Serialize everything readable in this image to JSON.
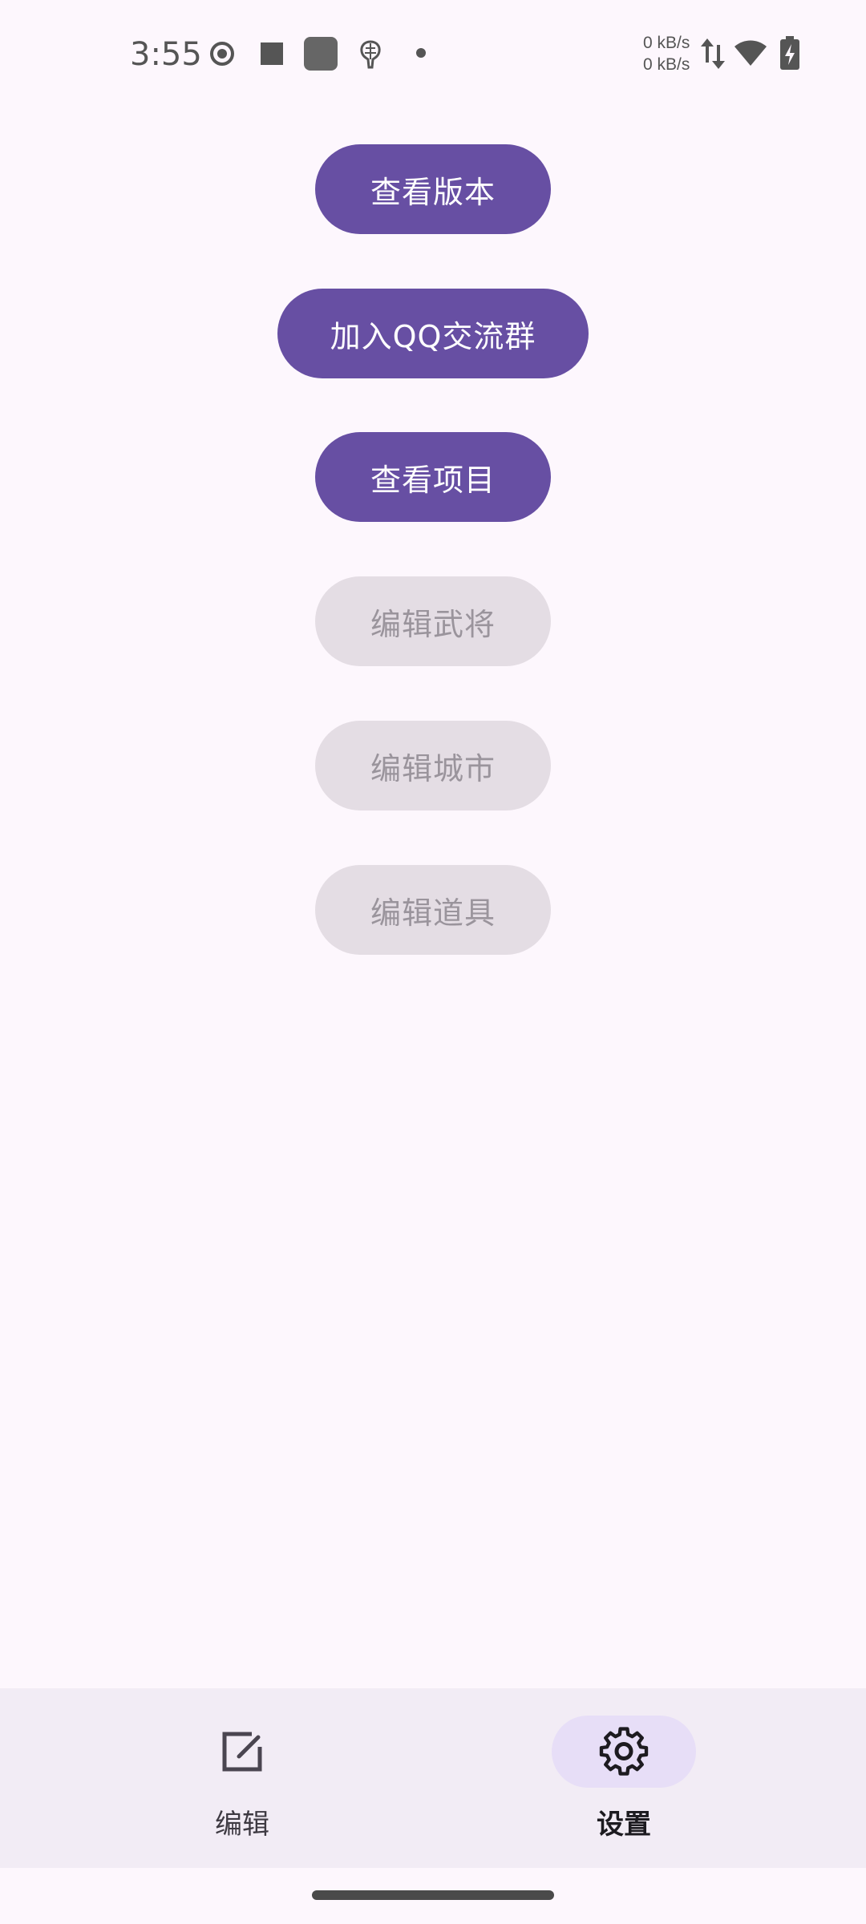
{
  "status_bar": {
    "time": "3:55",
    "upload_speed": "0 kB/s",
    "download_speed": "0 kB/s",
    "icons": [
      "record-icon",
      "stop-square-icon",
      "app-square-icon",
      "brain-icon",
      "dot-icon",
      "data-arrows-icon",
      "wifi-icon",
      "battery-charging-icon"
    ]
  },
  "buttons": [
    {
      "label": "查看版本",
      "enabled": true
    },
    {
      "label": "加入QQ交流群",
      "enabled": true
    },
    {
      "label": "查看项目",
      "enabled": true
    },
    {
      "label": "编辑武将",
      "enabled": false
    },
    {
      "label": "编辑城市",
      "enabled": false
    },
    {
      "label": "编辑道具",
      "enabled": false
    }
  ],
  "bottom_nav": {
    "items": [
      {
        "label": "编辑",
        "icon": "edit-icon",
        "active": false
      },
      {
        "label": "设置",
        "icon": "gear-icon",
        "active": true
      }
    ]
  },
  "colors": {
    "background": "#FDF7FD",
    "primary": "#674FA3",
    "disabled_bg": "#E4DDE4",
    "disabled_text": "#9A949C",
    "nav_bg": "#F2ECF5",
    "nav_indicator": "#E7DEF7"
  }
}
